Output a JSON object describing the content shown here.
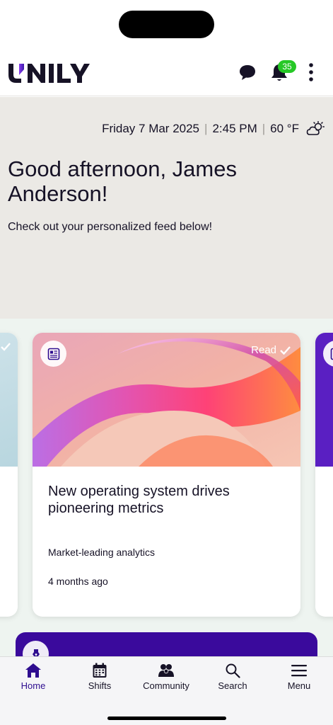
{
  "app": {
    "name": "UNILY"
  },
  "header": {
    "notification_count": "35"
  },
  "hero": {
    "date": "Friday 7 Mar 2025",
    "time": "2:45 PM",
    "temperature": "60 °F",
    "weather_icon": "partly-cloudy-icon",
    "greeting": "Good afternoon, James Anderson!",
    "subtitle": "Check out your personalized feed below!"
  },
  "feed": {
    "cards": [
      {
        "type_icon": "article-icon",
        "status": "Read",
        "title": "New operating system drives pioneering metrics",
        "description": "Market-leading analytics",
        "time_ago": "4 months ago"
      }
    ]
  },
  "tabs": [
    {
      "label": "Home",
      "icon": "home-icon",
      "active": true
    },
    {
      "label": "Shifts",
      "icon": "calendar-icon",
      "active": false
    },
    {
      "label": "Community",
      "icon": "community-icon",
      "active": false
    },
    {
      "label": "Search",
      "icon": "search-icon",
      "active": false
    },
    {
      "label": "Menu",
      "icon": "menu-icon",
      "active": false
    }
  ],
  "colors": {
    "brand": "#2e0d8f",
    "hero_bg": "#ebe9e5",
    "feed_bg": "#eef4f0",
    "badge": "#26c826",
    "promo": "#3a0a9c"
  }
}
